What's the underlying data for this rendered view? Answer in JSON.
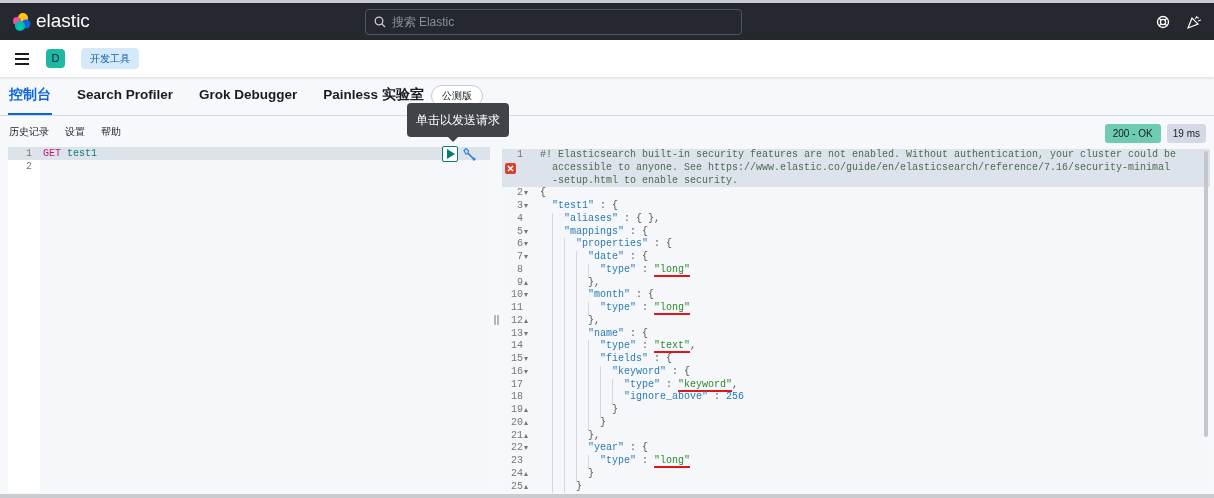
{
  "header": {
    "logo_text": "elastic",
    "search": {
      "placeholder": "搜索 Elastic"
    }
  },
  "breadcrumb": {
    "avatar": "D",
    "items": [
      "开发工具"
    ]
  },
  "tabs": [
    {
      "label": "控制台",
      "selected": true
    },
    {
      "label": "Search Profiler",
      "selected": false
    },
    {
      "label": "Grok Debugger",
      "selected": false
    },
    {
      "label": "Painless 实验室",
      "selected": false,
      "badge": "公测版"
    }
  ],
  "toolbar": {
    "links": [
      "历史记录",
      "设置",
      "帮助"
    ],
    "status": "200 - OK",
    "duration": "19 ms"
  },
  "tooltip": "单击以发送请求",
  "request_editor": {
    "lines": [
      {
        "number": "1",
        "active": true,
        "tokens": [
          {
            "text": "GET",
            "kind": "method"
          },
          {
            "text": " test1",
            "kind": "path"
          }
        ]
      },
      {
        "number": "2",
        "active": false
      }
    ]
  },
  "response_editor": {
    "lines": [
      {
        "number": "1",
        "active": true,
        "error": true,
        "comment_rows": [
          "#! Elasticsearch built-in security features are not enabled. Without authentication, your cluster could be",
          "accessible to anyone. See https://www.elastic.co/guide/en/elasticsearch/reference/7.16/security-minimal",
          "-setup.html to enable security."
        ]
      },
      {
        "number": "2",
        "active": false,
        "fold": "▾",
        "tokens": [
          {
            "text": "{",
            "kind": "punct"
          }
        ]
      },
      {
        "number": "3",
        "active": false,
        "fold": "▾",
        "tokens": [
          {
            "text": "  \"test1\"",
            "kind": "key"
          },
          {
            "text": " : {",
            "kind": "punct"
          }
        ]
      },
      {
        "number": "4",
        "active": false,
        "tokens": [
          {
            "text": "    \"aliases\"",
            "kind": "key"
          },
          {
            "text": " : { },",
            "kind": "punct"
          }
        ]
      },
      {
        "number": "5",
        "active": false,
        "fold": "▾",
        "tokens": [
          {
            "text": "    \"mappings\"",
            "kind": "key"
          },
          {
            "text": " : {",
            "kind": "punct"
          }
        ]
      },
      {
        "number": "6",
        "active": false,
        "fold": "▾",
        "tokens": [
          {
            "text": "      \"properties\"",
            "kind": "key"
          },
          {
            "text": " : {",
            "kind": "punct"
          }
        ]
      },
      {
        "number": "7",
        "active": false,
        "fold": "▾",
        "tokens": [
          {
            "text": "        \"date\"",
            "kind": "key"
          },
          {
            "text": " : {",
            "kind": "punct"
          }
        ]
      },
      {
        "number": "8",
        "active": false,
        "tokens": [
          {
            "text": "          \"type\"",
            "kind": "key"
          },
          {
            "text": " : ",
            "kind": "punct"
          },
          {
            "text": "\"long\"",
            "kind": "string",
            "marked": true
          }
        ]
      },
      {
        "number": "9",
        "active": false,
        "fold": "▴",
        "tokens": [
          {
            "text": "        },",
            "kind": "punct"
          }
        ]
      },
      {
        "number": "10",
        "active": false,
        "fold": "▾",
        "tokens": [
          {
            "text": "        \"month\"",
            "kind": "key"
          },
          {
            "text": " : {",
            "kind": "punct"
          }
        ]
      },
      {
        "number": "11",
        "active": false,
        "tokens": [
          {
            "text": "          \"type\"",
            "kind": "key"
          },
          {
            "text": " : ",
            "kind": "punct"
          },
          {
            "text": "\"long\"",
            "kind": "string",
            "marked": true
          }
        ]
      },
      {
        "number": "12",
        "active": false,
        "fold": "▴",
        "tokens": [
          {
            "text": "        },",
            "kind": "punct"
          }
        ]
      },
      {
        "number": "13",
        "active": false,
        "fold": "▾",
        "tokens": [
          {
            "text": "        \"name\"",
            "kind": "key"
          },
          {
            "text": " : {",
            "kind": "punct"
          }
        ]
      },
      {
        "number": "14",
        "active": false,
        "tokens": [
          {
            "text": "          \"type\"",
            "kind": "key"
          },
          {
            "text": " : ",
            "kind": "punct"
          },
          {
            "text": "\"text\"",
            "kind": "string",
            "marked": true
          },
          {
            "text": ",",
            "kind": "punct"
          }
        ]
      },
      {
        "number": "15",
        "active": false,
        "fold": "▾",
        "tokens": [
          {
            "text": "          \"fields\"",
            "kind": "key"
          },
          {
            "text": " : {",
            "kind": "punct"
          }
        ]
      },
      {
        "number": "16",
        "active": false,
        "fold": "▾",
        "tokens": [
          {
            "text": "            \"keyword\"",
            "kind": "key"
          },
          {
            "text": " : {",
            "kind": "punct"
          }
        ]
      },
      {
        "number": "17",
        "active": false,
        "tokens": [
          {
            "text": "              \"type\"",
            "kind": "key"
          },
          {
            "text": " : ",
            "kind": "punct"
          },
          {
            "text": "\"keyword\"",
            "kind": "string",
            "marked": true
          },
          {
            "text": ",",
            "kind": "punct"
          }
        ]
      },
      {
        "number": "18",
        "active": false,
        "tokens": [
          {
            "text": "              \"ignore_above\"",
            "kind": "key"
          },
          {
            "text": " : ",
            "kind": "punct"
          },
          {
            "text": "256",
            "kind": "number"
          }
        ]
      },
      {
        "number": "19",
        "active": false,
        "fold": "▴",
        "tokens": [
          {
            "text": "            }",
            "kind": "punct"
          }
        ]
      },
      {
        "number": "20",
        "active": false,
        "fold": "▴",
        "tokens": [
          {
            "text": "          }",
            "kind": "punct"
          }
        ]
      },
      {
        "number": "21",
        "active": false,
        "fold": "▴",
        "tokens": [
          {
            "text": "        },",
            "kind": "punct"
          }
        ]
      },
      {
        "number": "22",
        "active": false,
        "fold": "▾",
        "tokens": [
          {
            "text": "        \"year\"",
            "kind": "key"
          },
          {
            "text": " : {",
            "kind": "punct"
          }
        ]
      },
      {
        "number": "23",
        "active": false,
        "tokens": [
          {
            "text": "          \"type\"",
            "kind": "key"
          },
          {
            "text": " : ",
            "kind": "punct"
          },
          {
            "text": "\"long\"",
            "kind": "string",
            "marked": true
          }
        ]
      },
      {
        "number": "24",
        "active": false,
        "fold": "▴",
        "tokens": [
          {
            "text": "        }",
            "kind": "punct"
          }
        ]
      },
      {
        "number": "25",
        "active": false,
        "fold": "▴",
        "tokens": [
          {
            "text": "      }",
            "kind": "punct"
          }
        ]
      }
    ]
  }
}
